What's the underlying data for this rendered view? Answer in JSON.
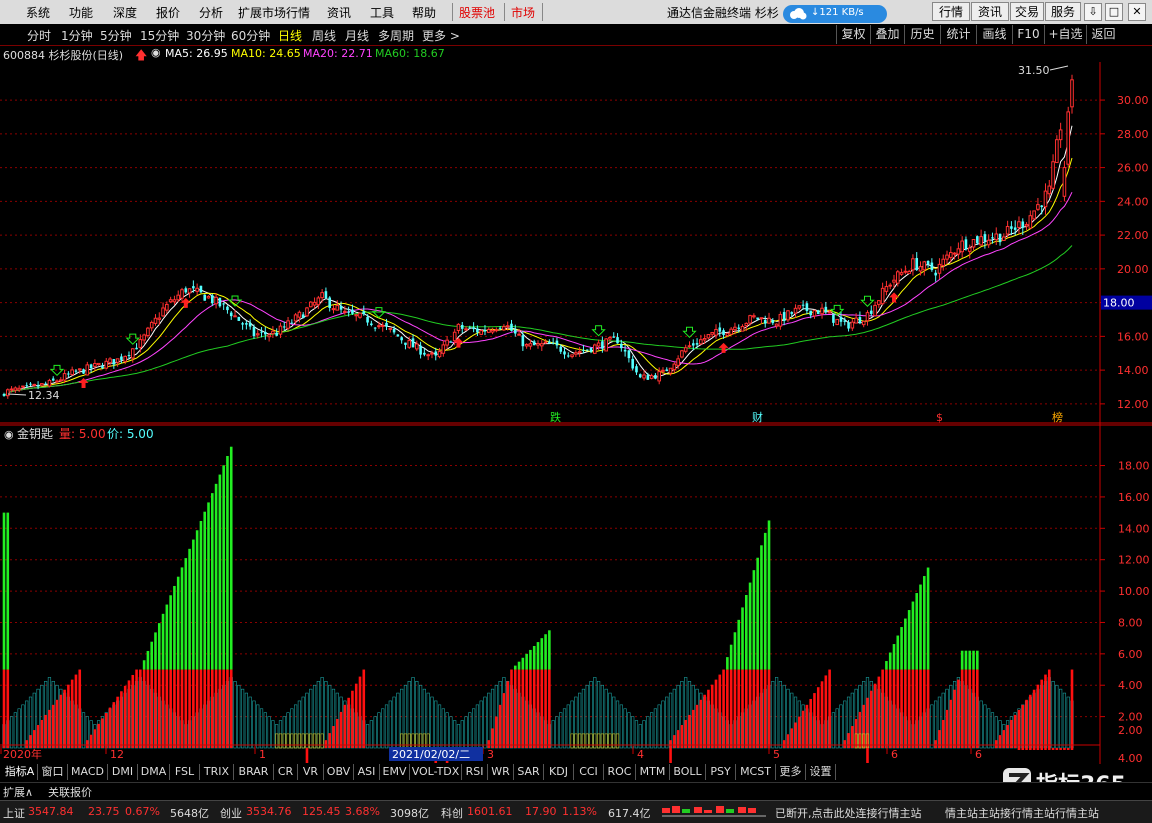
{
  "menu": {
    "items": [
      "系统",
      "功能",
      "深度",
      "报价",
      "分析",
      "扩展市场行情",
      "资讯",
      "工具",
      "帮助"
    ],
    "highlight_items": [
      "股票池",
      "市场"
    ],
    "title": "通达信金融终端 杉杉",
    "cloud_speed": "↓121 KB/s",
    "right_buttons": [
      "行情",
      "资讯",
      "交易",
      "服务"
    ],
    "window_buttons": [
      "⇩",
      "□",
      "✕"
    ]
  },
  "periods": {
    "items": [
      "分时",
      "1分钟",
      "5分钟",
      "15分钟",
      "30分钟",
      "60分钟",
      "日线",
      "周线",
      "月线",
      "多周期",
      "更多 >"
    ],
    "active_index": 6,
    "right_buttons": [
      "复权",
      "叠加",
      "历史",
      "统计",
      "画线",
      "F10",
      "+自选",
      "返回"
    ]
  },
  "info": {
    "stock": "600884 杉杉股份(日线)",
    "ma5": "MA5: 26.95",
    "ma10": "MA10: 24.65",
    "ma20": "MA20: 22.71",
    "ma60": "MA60: 18.67"
  },
  "colors": {
    "up": "#ff3030",
    "down": "#54ffff",
    "ma5": "#ffffff",
    "ma10": "#ffff00",
    "ma20": "#ff44ff",
    "ma60": "#22cc22",
    "grid": "#8b0000",
    "axis": "#cc0000",
    "vol_green": "#22ee22",
    "vol_red": "#ff1010",
    "vol_cyan": "#1aa0a0",
    "vol_yellow": "#c8c830"
  },
  "price_axis": {
    "ticks": [
      "30.00",
      "28.00",
      "26.00",
      "24.00",
      "22.00",
      "20.00",
      "18.00",
      "16.00",
      "14.00",
      "12.00"
    ],
    "current_price": "18.00"
  },
  "annotations": {
    "high_label": "31.50",
    "low_label": "12.34",
    "event_tags": [
      "跌",
      "财",
      "$",
      "榜"
    ]
  },
  "indicator": {
    "name": "金钥匙",
    "vol_label": "量: 5.00",
    "price_label": "价: 5.00",
    "ticks": [
      "18.00",
      "16.00",
      "14.00",
      "12.00",
      "10.00",
      "8.00",
      "6.00",
      "4.00",
      "2.00",
      "2.00",
      "4.00"
    ]
  },
  "time_axis": {
    "labels": [
      "2020年",
      "12",
      "1",
      "3",
      "4",
      "5",
      "6",
      "6"
    ],
    "cursor_date": "2021/02/02/二"
  },
  "indicator_tabs": [
    "指标A",
    "窗口",
    "MACD",
    "DMI",
    "DMA",
    "FSL",
    "TRIX",
    "BRAR",
    "CR",
    "VR",
    "OBV",
    "ASI",
    "EMV",
    "VOL-TDX",
    "RSI",
    "WR",
    "SAR",
    "KDJ",
    "CCI",
    "ROC",
    "MTM",
    "BOLL",
    "PSY",
    "MCST",
    "更多",
    "设置"
  ],
  "ext_tabs": [
    "扩展∧",
    "关联报价"
  ],
  "status": {
    "sh_name": "上证",
    "sh_index": "3547.84",
    "sh_change": "23.75",
    "sh_pct": "0.67%",
    "sh_amount": "5648亿",
    "cy_name": "创业",
    "cy_index": "3534.76",
    "cy_change": "125.45",
    "cy_pct": "3.68%",
    "cy_amount": "3098亿",
    "kc_name": "科创",
    "kc_index": "1601.61",
    "kc_change": "17.90",
    "kc_pct": "1.13%",
    "kc_amount": "617.4亿",
    "message": "已断开,点击此处连接行情主站",
    "message_scroll": "情主站主站接行情主站行情主站"
  },
  "watermark": "指标365",
  "chart_data": {
    "type": "candlestick",
    "title": "600884 杉杉股份(日线)",
    "ylim": [
      11.4,
      31.9
    ],
    "series_desc": "daily OHLC with MA5/MA10/MA20/MA60, Dec 2020 to Jul 2021, low 12.34, high 31.50",
    "anchors": [
      [
        0,
        12.7
      ],
      [
        6,
        12.9
      ],
      [
        12,
        13.2
      ],
      [
        18,
        13.8
      ],
      [
        24,
        14.2
      ],
      [
        30,
        14.6
      ],
      [
        36,
        15.6
      ],
      [
        42,
        17.6
      ],
      [
        48,
        18.8
      ],
      [
        54,
        18.3
      ],
      [
        60,
        17.4
      ],
      [
        66,
        16.1
      ],
      [
        72,
        16.2
      ],
      [
        78,
        17.2
      ],
      [
        84,
        18.3
      ],
      [
        90,
        17.3
      ],
      [
        96,
        17.0
      ],
      [
        102,
        16.3
      ],
      [
        108,
        15.4
      ],
      [
        114,
        14.7
      ],
      [
        120,
        16.5
      ],
      [
        126,
        16.3
      ],
      [
        132,
        16.8
      ],
      [
        138,
        15.4
      ],
      [
        144,
        15.5
      ],
      [
        150,
        15.0
      ],
      [
        156,
        15.4
      ],
      [
        162,
        15.8
      ],
      [
        168,
        13.5
      ],
      [
        174,
        13.8
      ],
      [
        180,
        15.3
      ],
      [
        186,
        16.0
      ],
      [
        192,
        16.5
      ],
      [
        198,
        17.1
      ],
      [
        204,
        16.9
      ],
      [
        210,
        17.6
      ],
      [
        216,
        17.5
      ],
      [
        222,
        16.6
      ],
      [
        228,
        17.3
      ],
      [
        234,
        19.2
      ],
      [
        240,
        20.3
      ],
      [
        246,
        19.9
      ],
      [
        252,
        21.4
      ],
      [
        258,
        21.8
      ],
      [
        264,
        22.0
      ],
      [
        270,
        22.9
      ],
      [
        276,
        24.6
      ],
      [
        279,
        28.5
      ],
      [
        282,
        31.3
      ]
    ],
    "volume_bars_desc": "金钥匙 indicator histogram, 0 to 19"
  }
}
